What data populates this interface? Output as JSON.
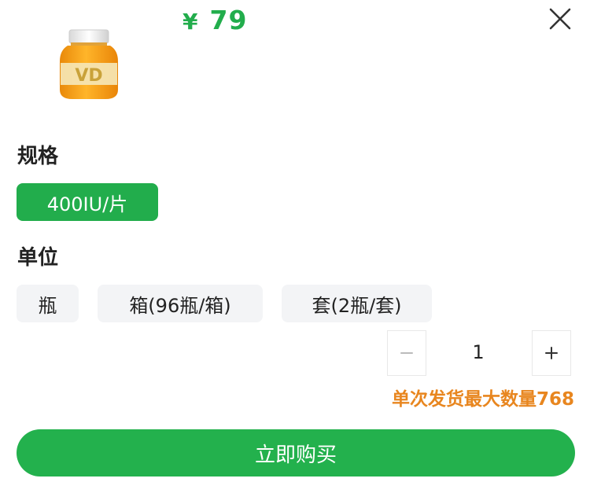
{
  "product": {
    "price_symbol": "¥",
    "price": "79",
    "image_label": "VD"
  },
  "spec": {
    "title": "规格",
    "options": [
      "400IU/片"
    ],
    "selected_index": 0
  },
  "unit": {
    "title": "单位",
    "options": [
      "瓶",
      "箱(96瓶/箱)",
      "套(2瓶/套)"
    ]
  },
  "quantity": {
    "value": "1",
    "minus_label": "−",
    "plus_label": "+"
  },
  "max_note": "单次发货最大数量768",
  "buy_button_label": "立即购买",
  "colors": {
    "accent": "#22ad4c",
    "warning": "#e8861f",
    "chip_bg": "#f3f4f6"
  },
  "icons": {
    "close": "close-icon",
    "minus": "minus-icon",
    "plus": "plus-icon"
  }
}
